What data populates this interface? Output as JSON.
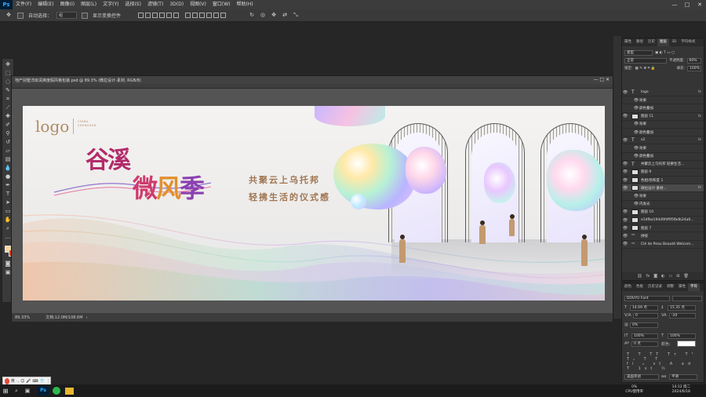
{
  "app": {
    "logo": "Ps"
  },
  "menu": [
    "文件(F)",
    "编辑(E)",
    "图像(I)",
    "图层(L)",
    "文字(Y)",
    "选择(S)",
    "滤镜(T)",
    "3D(D)",
    "视图(V)",
    "窗口(W)",
    "帮助(H)"
  ],
  "window_controls": {
    "minimize": "—",
    "maximize": "□",
    "close": "✕"
  },
  "options": {
    "auto_select_label": "自动选择：",
    "auto_select_value": "组",
    "show_transform_label": "显示变换控件"
  },
  "document": {
    "tab_title": "地产别墅洋房清爽度假风格包装.psd @ 89.3% (微拉设计-素材, RGB/8)",
    "zoom": "89.33%",
    "doc_size": "文档:12.0M/108.6M"
  },
  "artwork": {
    "logo": "logo",
    "logo_en_line1": "CHINA",
    "logo_en_line2": "SHENGXUN",
    "title_line1": "谷溪",
    "title_line2_a": "微",
    "title_line2_b": "风",
    "title_line2_c": "季",
    "tagline1": "共聚云上乌托邦",
    "tagline2": "轻拂生活的仪式感"
  },
  "layers_panel": {
    "tabs": [
      "属性",
      "路径",
      "历史",
      "图层",
      "3D",
      "字符样式"
    ],
    "active_tab": "图层",
    "filter_kind": "类型",
    "blend_mode": "正常",
    "opacity_label": "不透明度:",
    "opacity": "60%",
    "lock_label": "锁定:",
    "fill_label": "填充:",
    "fill": "100%",
    "layers": [
      {
        "name": "logo",
        "type": "text",
        "fx": "fx",
        "sub": false
      },
      {
        "name": "效果",
        "type": "effect",
        "sub": true
      },
      {
        "name": "颜色叠加",
        "type": "effect",
        "sub": true
      },
      {
        "name": "图层 11",
        "type": "image",
        "fx": "fx",
        "sub": false
      },
      {
        "name": "效果",
        "type": "effect",
        "sub": true
      },
      {
        "name": "颜色叠加",
        "type": "effect",
        "sub": true
      },
      {
        "name": "s2",
        "type": "text",
        "fx": "fx",
        "sub": false
      },
      {
        "name": "效果",
        "type": "effect",
        "sub": true
      },
      {
        "name": "颜色叠加",
        "type": "effect",
        "sub": true
      },
      {
        "name": "共聚云上乌托邦 轻拂生活...",
        "type": "text",
        "sub": false
      },
      {
        "name": "图层 9",
        "type": "image",
        "sub": false
      },
      {
        "name": "色相/饱和度 1",
        "type": "adjust",
        "sub": false
      },
      {
        "name": "微拉设计-素材...",
        "type": "smart",
        "fx": "fx",
        "sub": false,
        "selected": true
      },
      {
        "name": "效果",
        "type": "effect",
        "sub": true
      },
      {
        "name": "内发光",
        "type": "effect",
        "sub": true
      },
      {
        "name": "图层 10",
        "type": "image",
        "sub": false
      },
      {
        "name": "e1dfba194d9fdf95fbdb24a6...",
        "type": "image",
        "sub": false
      },
      {
        "name": "图层 7",
        "type": "image",
        "sub": false
      },
      {
        "name": "拼接",
        "type": "group",
        "sub": false
      },
      {
        "name": "Clé de Peau Beauté Welcom...",
        "type": "group",
        "sub": false
      }
    ]
  },
  "char_panel": {
    "tabs": [
      "颜色",
      "色板",
      "历史记录",
      "调整",
      "属性",
      "字符"
    ],
    "font": "DOUYU Font",
    "size": "14.69 点",
    "leading": "15.35 点",
    "kerning": "0",
    "tracking": "-20",
    "scale_label": "0%",
    "vscale": "100%",
    "hscale": "100%",
    "baseline": "0 点",
    "color_label": "颜色:",
    "language": "美国英语",
    "aa": "平滑"
  },
  "taskbar": {
    "ime": "英",
    "cpu_value": "0%",
    "cpu_label": "CPU使用率",
    "time": "14:12 周二",
    "date": "2024/6/18"
  }
}
